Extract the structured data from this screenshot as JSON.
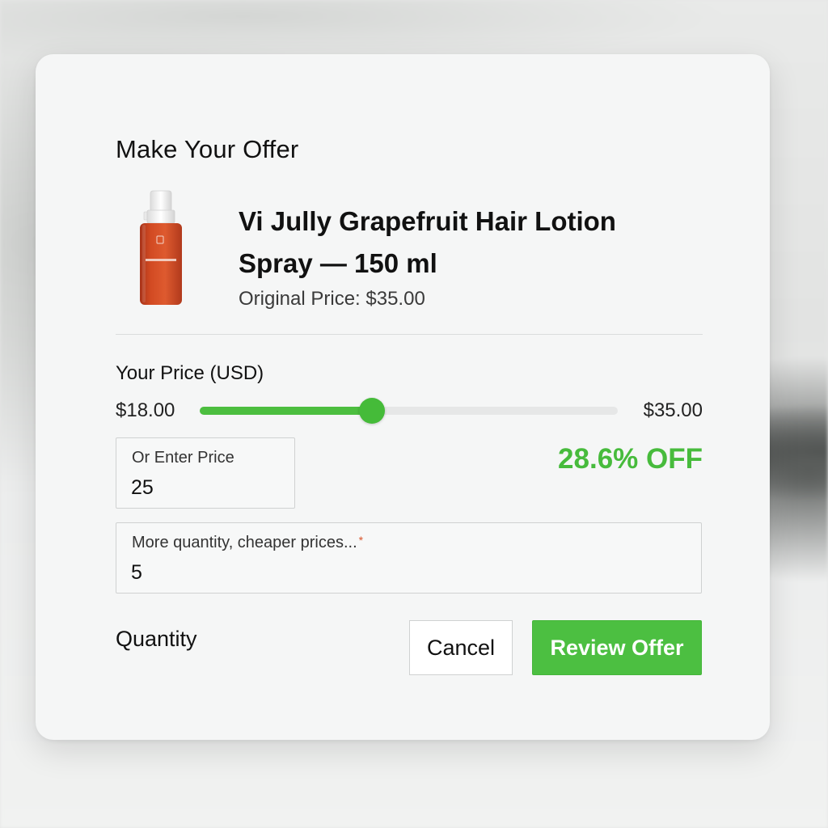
{
  "dialog": {
    "title": "Make Your Offer"
  },
  "product": {
    "name": "Vi Jully Grapefruit Hair Lotion Spray — 150 ml",
    "original_price_text": "Original Price: $35.00",
    "image_icon": "orange-spray-bottle",
    "bottle_color": "#d24a22"
  },
  "price": {
    "label": "Your Price (USD)",
    "slider": {
      "min_label": "$18.00",
      "max_label": "$35.00",
      "min": 18,
      "max": 35,
      "value": 25
    },
    "input": {
      "label": "Or Enter Price",
      "value": "25"
    },
    "discount_text": "28.6% OFF"
  },
  "quantity": {
    "input_label": "More quantity, cheaper prices...",
    "required_mark": "*",
    "value": "5",
    "label": "Quantity"
  },
  "actions": {
    "cancel_label": "Cancel",
    "review_label": "Review Offer"
  },
  "colors": {
    "accent_green": "#4cbf41",
    "discount_green": "#47bb3c",
    "modal_bg": "#f5f6f6"
  }
}
